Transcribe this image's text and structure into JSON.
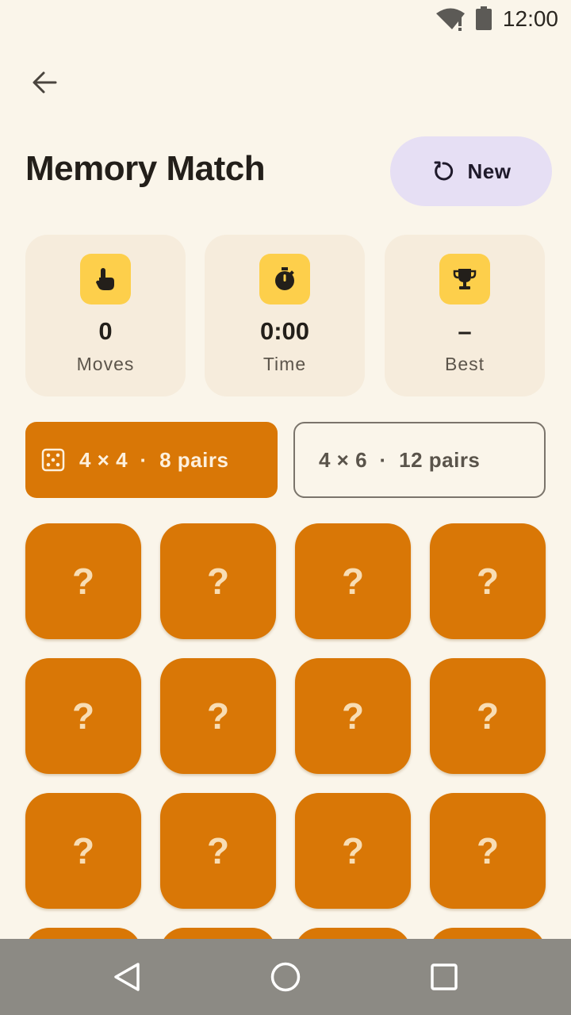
{
  "status_bar": {
    "time": "12:00",
    "wifi_icon": "wifi-alert-icon",
    "battery_icon": "battery-icon"
  },
  "header": {
    "back_icon": "arrow-left-icon",
    "title": "Memory Match",
    "new_button": {
      "label": "New",
      "icon": "refresh-icon"
    }
  },
  "stats": [
    {
      "icon": "touch-icon",
      "value": "0",
      "label": "Moves"
    },
    {
      "icon": "stopwatch-icon",
      "value": "0:00",
      "label": "Time"
    },
    {
      "icon": "trophy-icon",
      "value": "–",
      "label": "Best"
    }
  ],
  "modes": [
    {
      "label": "4 × 4  ·  8 pairs",
      "icon": "dice-icon",
      "selected": true
    },
    {
      "label": "4 × 6  ·  12 pairs",
      "selected": false
    }
  ],
  "cards": [
    "?",
    "?",
    "?",
    "?",
    "?",
    "?",
    "?",
    "?",
    "?",
    "?",
    "?",
    "?",
    "?",
    "?",
    "?",
    "?"
  ],
  "colors": {
    "background": "#faf5ea",
    "accent": "#d97706",
    "icon_tile": "#fdcf4b",
    "new_button_bg": "#e6dff4",
    "stat_card_bg": "#f6ecdc"
  },
  "nav_bar": {
    "back_icon": "nav-back-icon",
    "home_icon": "nav-home-icon",
    "recents_icon": "nav-recents-icon"
  }
}
